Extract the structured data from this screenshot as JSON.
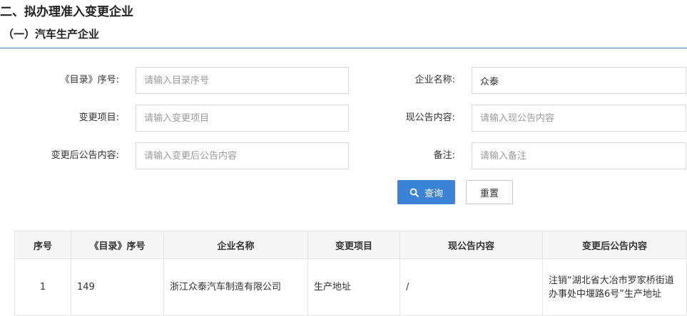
{
  "section_title": "二、拟办理准入变更企业",
  "sub_title": "（一）汽车生产企业",
  "form": {
    "catalog_no": {
      "label": "《目录》序号:",
      "placeholder": "请输入目录序号",
      "value": ""
    },
    "company_name": {
      "label": "企业名称:",
      "placeholder": "",
      "value": "众泰"
    },
    "change_item": {
      "label": "变更项目:",
      "placeholder": "请输入变更项目",
      "value": ""
    },
    "current_notice": {
      "label": "现公告内容:",
      "placeholder": "请输入现公告内容",
      "value": ""
    },
    "changed_notice": {
      "label": "变更后公告内容:",
      "placeholder": "请输入变更后公告内容",
      "value": ""
    },
    "remark": {
      "label": "备注:",
      "placeholder": "请输入备注",
      "value": ""
    }
  },
  "buttons": {
    "search": "查询",
    "reset": "重置"
  },
  "table": {
    "headers": [
      "序号",
      "《目录》序号",
      "企业名称",
      "变更项目",
      "现公告内容",
      "变更后公告内容"
    ],
    "rows": [
      [
        "1",
        "149",
        "浙江众泰汽车制造有限公司",
        "生产地址",
        "/",
        "注销“湖北省大冶市罗家桥街道办事处中堰路6号”生产地址"
      ]
    ]
  },
  "colors": {
    "primary": "#3b83d6",
    "divider": "#4a7fc8",
    "header_bg": "#f5f5f5"
  }
}
